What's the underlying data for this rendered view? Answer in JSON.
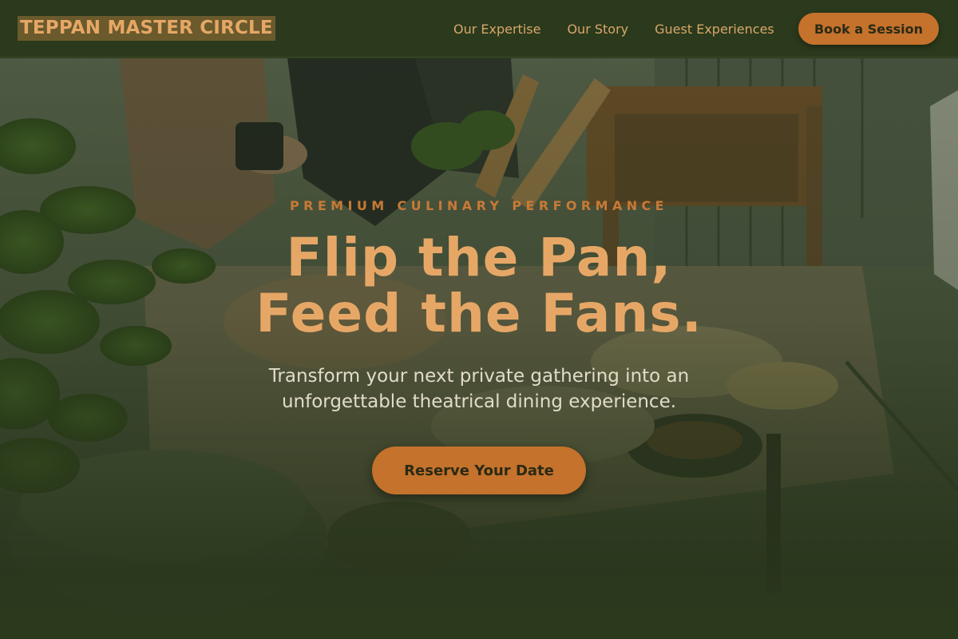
{
  "header": {
    "brand": "TEPPAN MASTER CIRCLE",
    "nav": [
      {
        "label": "Our Expertise"
      },
      {
        "label": "Our Story"
      },
      {
        "label": "Guest Experiences"
      }
    ],
    "cta_label": "Book a Session"
  },
  "hero": {
    "eyebrow": "PREMIUM CULINARY PERFORMANCE",
    "headline_line1": "Flip the Pan,",
    "headline_line2": "Feed the Fans.",
    "subtitle_line1": "Transform your next private gathering into an",
    "subtitle_line2": "unforgettable theatrical dining experience.",
    "cta_label": "Reserve Your Date"
  },
  "colors": {
    "header_bg": "#2b3a1c",
    "accent": "#c4722c",
    "brand_text": "#e6a766",
    "nav_text": "#d9a66a",
    "eyebrow": "#c77a36",
    "subtitle": "#e1dcc8"
  }
}
